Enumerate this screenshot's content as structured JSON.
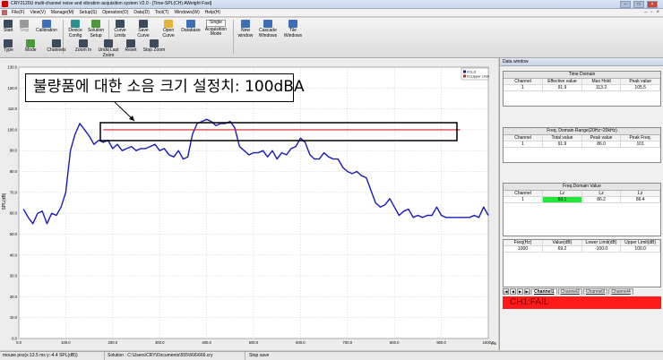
{
  "window": {
    "title": "CRY2120U multi-channel noise and vibration acquisition system V2.0 - [Time-SPL(CH) AWeight Fast]"
  },
  "menu": [
    "File(F)",
    "View(V)",
    "Manage(M)",
    "Setup(S)",
    "Operation(O)",
    "Data(D)",
    "Tool(T)",
    "Windows(W)",
    "Help(H)"
  ],
  "toolbar": {
    "start": "Start",
    "stop": "Stop",
    "calibration": "Calibration",
    "device_config": "Device Config",
    "solution_setup": "Solution Setup",
    "curve_limits": "Curve Limits",
    "save_curve": "Save Curve",
    "open_curve": "Open Curve",
    "database": "Database",
    "acq_mode_value": "Single",
    "acq_mode": "Acquisition Mode",
    "new_window": "New window",
    "cascade": "Cascade Windows",
    "tile": "Tile Windows",
    "type": "Type",
    "mode": "Mode",
    "channels": "Channels",
    "zoom_in": "Zoom In",
    "undo_zoom": "Undo Last Zoom",
    "reset": "Reset",
    "stop_zoom": "Stop Zoom"
  },
  "annotation": "불량품에 대한 소음 크기 설정치: 100dBA",
  "chart_data": {
    "type": "line",
    "ylabel": "SPL(dB)",
    "xunit": "ms",
    "xlim": [
      0,
      1000
    ],
    "ylim": [
      0,
      130
    ],
    "x_ticks": [
      "0.0",
      "100.0",
      "200.0",
      "300.0",
      "400.0",
      "500.0",
      "600.0",
      "700.0",
      "800.0",
      "900.0",
      "1000.0"
    ],
    "y_ticks": [
      "0.0",
      "10.0",
      "20.0",
      "30.0",
      "40.0",
      "50.0",
      "60.0",
      "70.0",
      "80.0",
      "90.0",
      "100.0",
      "110.0",
      "120.0",
      "130.0"
    ],
    "legend": [
      "01:Lzt",
      "01:Upper Limit"
    ],
    "grid": true,
    "series": [
      {
        "name": "01:Lzt",
        "color": "#1a1ab8",
        "x": [
          10,
          20,
          30,
          40,
          50,
          60,
          70,
          80,
          90,
          100,
          110,
          120,
          130,
          140,
          150,
          160,
          170,
          180,
          190,
          200,
          210,
          220,
          230,
          240,
          250,
          260,
          270,
          280,
          290,
          300,
          310,
          320,
          330,
          340,
          350,
          360,
          370,
          380,
          390,
          400,
          410,
          420,
          430,
          440,
          450,
          460,
          470,
          480,
          490,
          500,
          510,
          520,
          530,
          540,
          550,
          560,
          570,
          580,
          590,
          600,
          610,
          620,
          630,
          640,
          650,
          660,
          670,
          680,
          690,
          700,
          710,
          720,
          730,
          740,
          750,
          760,
          770,
          780,
          790,
          800,
          810,
          820,
          830,
          840,
          850,
          860,
          870,
          880,
          890,
          900,
          910,
          920,
          930,
          940,
          950,
          960,
          970,
          980,
          990,
          1000
        ],
        "y": [
          62,
          58,
          55,
          60,
          61,
          55,
          60,
          59,
          63,
          70,
          90,
          98,
          103,
          100,
          97,
          93,
          95,
          94,
          95,
          91,
          93,
          90,
          91,
          92,
          90,
          91,
          91,
          92,
          93,
          90,
          91,
          88,
          87,
          90,
          86,
          87,
          98,
          103,
          104,
          105,
          104,
          102,
          103,
          103,
          104,
          101,
          92,
          90,
          88,
          89,
          89,
          90,
          87,
          90,
          86,
          89,
          88,
          91,
          92,
          96,
          94,
          88,
          86,
          86,
          89,
          87,
          86,
          86,
          82,
          80,
          79,
          80,
          78,
          77,
          71,
          65,
          63,
          64,
          67,
          63,
          59,
          61,
          62,
          58,
          59,
          58,
          59,
          59,
          63,
          59,
          58,
          58,
          58,
          58,
          58,
          58,
          59,
          58,
          63,
          59
        ]
      },
      {
        "name": "01:Upper Limit",
        "color": "#d0202a",
        "x": [
          180,
          940
        ],
        "y": [
          100,
          100
        ]
      }
    ]
  },
  "data_window": {
    "title": "Data window",
    "time_domain": {
      "title": "Time Domain",
      "headers": [
        "Channel",
        "Effective value",
        "Max Hold",
        "Peak value"
      ],
      "row": [
        "1",
        "91.9",
        "113.2",
        "105.5"
      ]
    },
    "freq_domain_range": {
      "title": "Freq. Domain Range(20Hz~20kHz)",
      "headers": [
        "Channel",
        "Total value",
        "Peak value",
        "Peak Freq."
      ],
      "row": [
        "1",
        "91.9",
        "86.0",
        "101"
      ]
    },
    "freq_domain_value": {
      "title": "Freq.Domain Value",
      "headers": [
        "Channel",
        "Lz",
        "Lz",
        "Lz"
      ],
      "row": [
        "1",
        "93.1",
        "86.2",
        "86.4"
      ]
    },
    "freq_table": {
      "headers": [
        "Freq(Hz)",
        "Value(dB)",
        "Lower Limit(dB)",
        "Upper Limit(dB)"
      ],
      "row": [
        "1000",
        "69.2",
        "-100.0",
        "100.0"
      ]
    },
    "channel_tabs": [
      "Channel1",
      "Channel2",
      "Channel3",
      "Channel4"
    ],
    "fail_text": "CH1:FAIL"
  },
  "status": {
    "mouse": "mouse pos(x:13.5 ms  y:-4.4 SPL(dB))",
    "solution": "Solution : C:\\Users\\CRY\\Documents\\555\\666\\666.cry",
    "state": "Stop save"
  }
}
